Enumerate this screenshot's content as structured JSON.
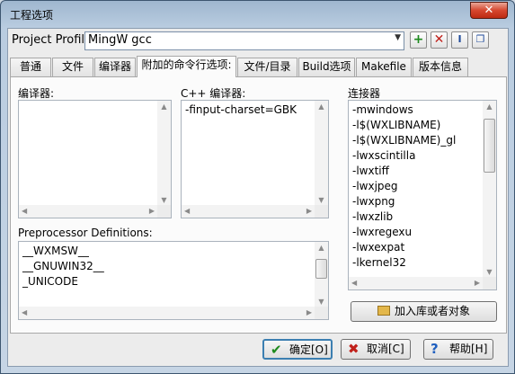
{
  "window": {
    "title": "工程选项",
    "close_label": "✕"
  },
  "profile": {
    "label": "Project Profile",
    "value": "MingW gcc"
  },
  "toolbar_icons": [
    "add-icon",
    "delete-icon",
    "rename-icon",
    "copy-icon"
  ],
  "tabs": [
    {
      "label": "普通"
    },
    {
      "label": "文件"
    },
    {
      "label": "编译器"
    },
    {
      "label": "附加的命令行选项:"
    },
    {
      "label": "文件/目录"
    },
    {
      "label": "Build选项"
    },
    {
      "label": "Makefile"
    },
    {
      "label": "版本信息"
    }
  ],
  "active_tab": "附加的命令行选项:",
  "compiler": {
    "label": "编译器:",
    "lines": []
  },
  "cpp_compiler": {
    "label": "C++ 编译器:",
    "lines": [
      "-finput-charset=GBK"
    ]
  },
  "linker": {
    "label": "连接器",
    "lines": [
      "-mwindows",
      "-l$(WXLIBNAME)",
      "-l$(WXLIBNAME)_gl",
      "-lwxscintilla",
      "-lwxtiff",
      "-lwxjpeg",
      "-lwxpng",
      "-lwxzlib",
      "-lwxregexu",
      "-lwxexpat",
      "-lkernel32"
    ]
  },
  "preprocessor": {
    "label": "Preprocessor Definitions:",
    "lines": [
      "__WXMSW__",
      "__GNUWIN32__",
      "_UNICODE"
    ]
  },
  "add_library_button": "加入库或者对象",
  "buttons": {
    "ok": "确定[O]",
    "cancel": "取消[C]",
    "help": "帮助[H]"
  },
  "colors": {
    "ok_check": "#1d8a1d",
    "cancel_x": "#c0201a",
    "help_q": "#1f5fbf"
  }
}
